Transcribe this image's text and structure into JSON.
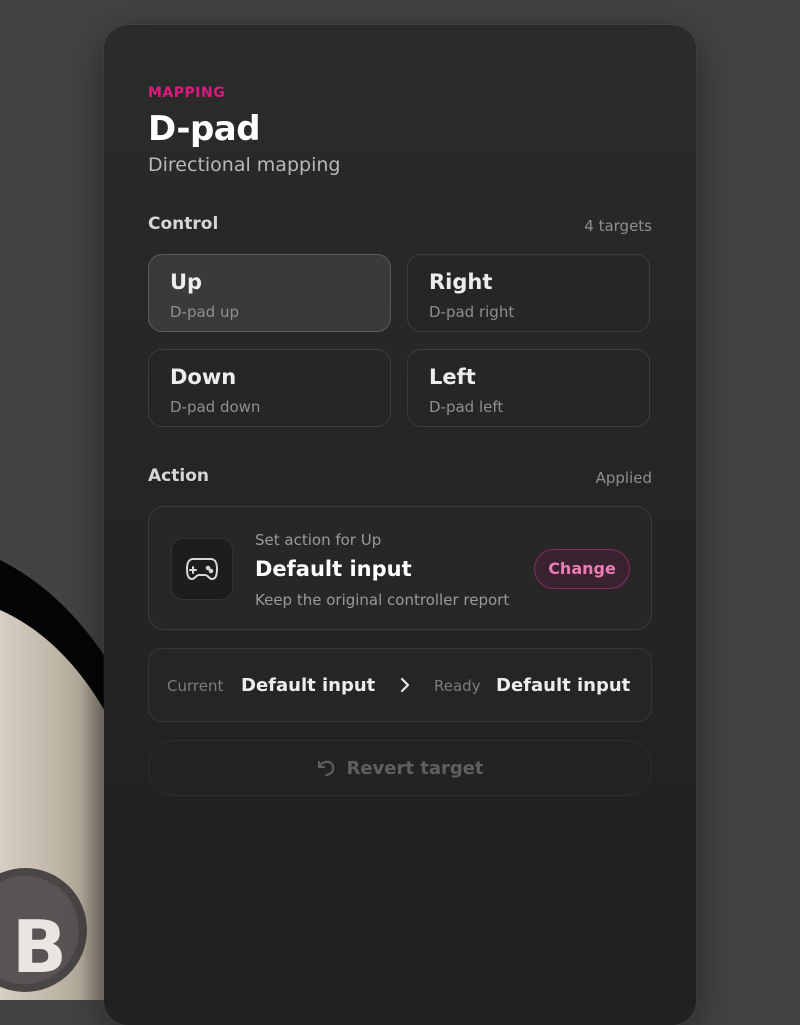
{
  "header": {
    "kicker": "MAPPING",
    "title": "D-pad",
    "subtitle": "Directional mapping"
  },
  "control": {
    "label": "Control",
    "count": "4 targets",
    "targets": [
      {
        "name": "Up",
        "sub": "D-pad up",
        "selected": true
      },
      {
        "name": "Right",
        "sub": "D-pad right",
        "selected": false
      },
      {
        "name": "Down",
        "sub": "D-pad down",
        "selected": false
      },
      {
        "name": "Left",
        "sub": "D-pad left",
        "selected": false
      }
    ]
  },
  "action": {
    "label": "Action",
    "status": "Applied",
    "caption": "Set action for Up",
    "title": "Default input",
    "description": "Keep the original controller report",
    "change_label": "Change",
    "icon": "gamepad-icon"
  },
  "status": {
    "current_label": "Current",
    "current_value": "Default input",
    "ready_label": "Ready",
    "ready_value": "Default input"
  },
  "revert": {
    "label": "Revert target",
    "icon": "undo-icon"
  },
  "colors": {
    "accent": "#e0177e",
    "panel": "#242424",
    "background": "#434343"
  }
}
